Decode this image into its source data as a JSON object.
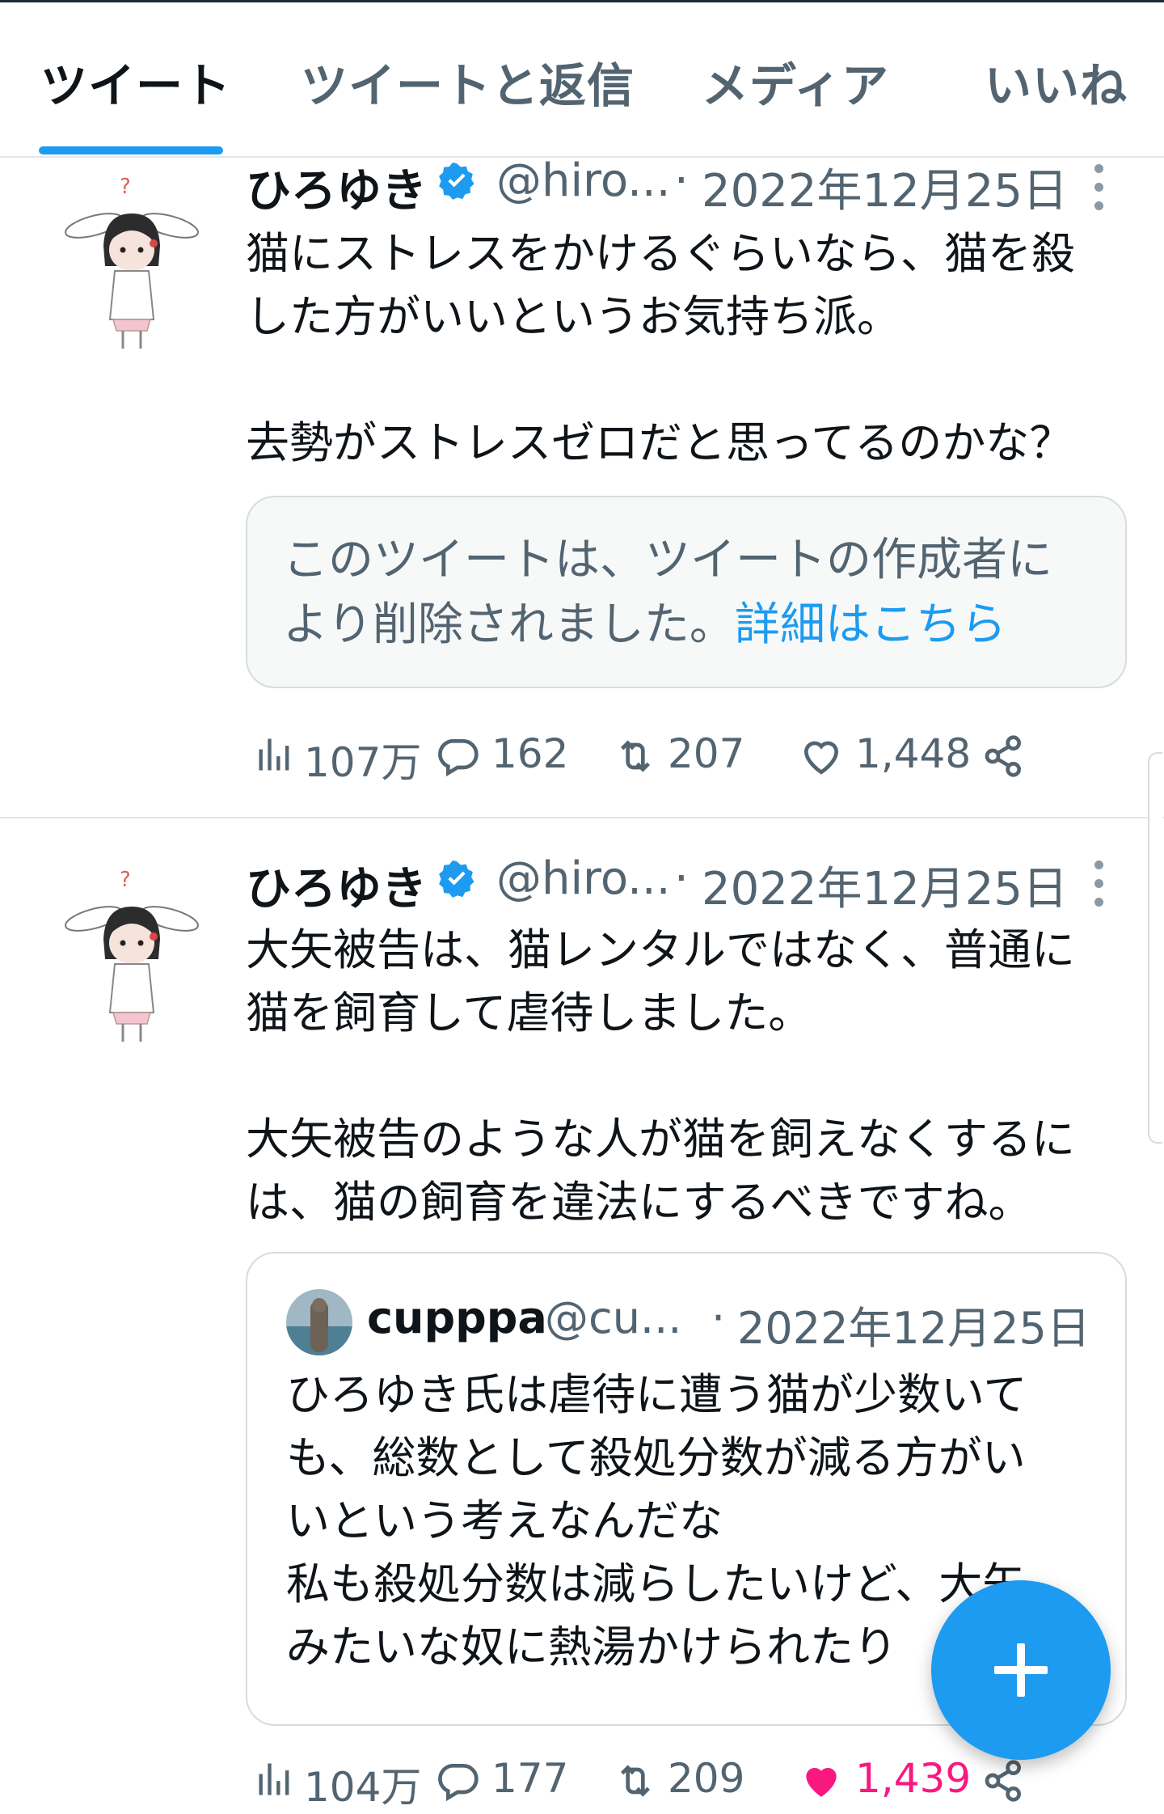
{
  "tabs": [
    {
      "label": "ツイート",
      "active": true
    },
    {
      "label": "ツイートと返信",
      "active": false
    },
    {
      "label": "メディア",
      "active": false
    },
    {
      "label": "いいね",
      "active": false
    }
  ],
  "colors": {
    "accent": "#1d9bf0",
    "text": "#0f1419",
    "muted": "#536471",
    "like": "#f91880",
    "border": "#e3e7ea"
  },
  "tweets": [
    {
      "author": "ひろゆき",
      "handle": "@hiro...",
      "separator": "·",
      "date": "2022年12月25日",
      "verified": true,
      "body_lines": [
        "猫にストレスをかけるぐらいなら、猫を殺",
        "した方がいいというお気持ち派。",
        "",
        "去勢がストレスゼロだと思ってるのかな？"
      ],
      "deleted_notice": {
        "line1": "このツイートは、ツイートの作成者に",
        "line2": "より削除されました。",
        "link": "詳細はこちら"
      },
      "stats": {
        "views": "107万",
        "replies": "162",
        "retweets": "207",
        "likes": "1,448",
        "liked": false
      }
    },
    {
      "author": "ひろゆき",
      "handle": "@hiro...",
      "separator": "·",
      "date": "2022年12月25日",
      "verified": true,
      "body_lines": [
        "大矢被告は、猫レンタルではなく、普通に",
        "猫を飼育して虐待しました。",
        "",
        "大矢被告のような人が猫を飼えなくするに",
        "は、猫の飼育を違法にするべきですね。"
      ],
      "quote": {
        "author": "cupppa",
        "handle": "@cu...",
        "separator": "·",
        "date": "2022年12月25日",
        "body_lines": [
          "ひろゆき氏は虐待に遭う猫が少数いて",
          "も、総数として殺処分数が減る方がい",
          "いという考えなんだな",
          "私も殺処分数は減らしたいけど、大矢",
          "みたいな奴に熱湯かけられたり"
        ]
      },
      "stats": {
        "views": "104万",
        "replies": "177",
        "retweets": "209",
        "likes": "1,439",
        "liked": true
      }
    }
  ],
  "icons": {
    "verified": "verified-badge-icon",
    "more": "more-vertical-icon",
    "views": "views-bar-chart-icon",
    "reply": "reply-bubble-icon",
    "retweet": "retweet-icon",
    "like": "heart-icon",
    "share": "share-icon",
    "compose": "plus-icon"
  }
}
